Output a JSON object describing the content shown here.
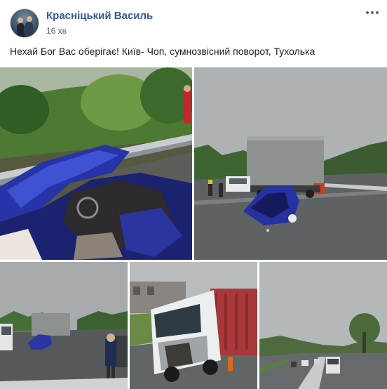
{
  "post": {
    "author": "Красніцький Василь",
    "time": "16 хв",
    "text": "Нехай Бог Вас оберігає! Київ- Чоп, сумнозвісний поворот, Тухолька",
    "more_icon": "more-dots-icon"
  },
  "photos": [
    {
      "name": "photo-wrecked-car-closeup"
    },
    {
      "name": "photo-truck-and-wreck-on-road"
    },
    {
      "name": "photo-police-at-crash-scene"
    },
    {
      "name": "photo-damaged-white-semi-truck"
    },
    {
      "name": "photo-mountain-road-traffic"
    }
  ]
}
